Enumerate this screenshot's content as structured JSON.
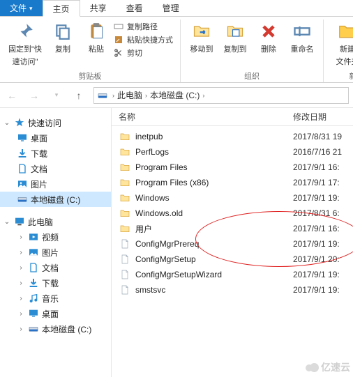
{
  "tabs": {
    "file": "文件",
    "home": "主页",
    "share": "共享",
    "view": "查看",
    "manage": "管理"
  },
  "ribbon": {
    "pin": {
      "l1": "固定到\"快",
      "l2": "速访问\""
    },
    "copy": "复制",
    "paste": "粘贴",
    "copy_path": "复制路径",
    "paste_shortcut": "粘贴快捷方式",
    "cut": "剪切",
    "clipboard_caption": "剪贴板",
    "move_to": "移动到",
    "copy_to": "复制到",
    "delete": "删除",
    "rename": "重命名",
    "new_folder": {
      "l1": "新建",
      "l2": "文件夹"
    },
    "organize_caption": "组织",
    "new_caption": "新"
  },
  "breadcrumb": {
    "root": "此电脑",
    "drive": "本地磁盘 (C:)"
  },
  "tree": {
    "quick_access": "快速访问",
    "desktop": "桌面",
    "downloads": "下载",
    "documents": "文档",
    "pictures": "图片",
    "local_disk": "本地磁盘 (C:)",
    "this_pc": "此电脑",
    "videos": "视频",
    "pictures2": "图片",
    "documents2": "文档",
    "downloads2": "下载",
    "music": "音乐",
    "desktop2": "桌面",
    "local_disk2": "本地磁盘 (C:)"
  },
  "list": {
    "col_name": "名称",
    "col_date": "修改日期",
    "items": [
      {
        "name": "inetpub",
        "type": "folder",
        "date": "2017/8/31 19"
      },
      {
        "name": "PerfLogs",
        "type": "folder",
        "date": "2016/7/16 21"
      },
      {
        "name": "Program Files",
        "type": "folder",
        "date": "2017/9/1 16:"
      },
      {
        "name": "Program Files (x86)",
        "type": "folder",
        "date": "2017/9/1 17:"
      },
      {
        "name": "Windows",
        "type": "folder",
        "date": "2017/9/1 19:"
      },
      {
        "name": "Windows.old",
        "type": "folder",
        "date": "2017/8/31 6:"
      },
      {
        "name": "用户",
        "type": "folder",
        "date": "2017/9/1 16:"
      },
      {
        "name": "ConfigMgrPrereq",
        "type": "file",
        "date": "2017/9/1 19:"
      },
      {
        "name": "ConfigMgrSetup",
        "type": "file",
        "date": "2017/9/1 20:"
      },
      {
        "name": "ConfigMgrSetupWizard",
        "type": "file",
        "date": "2017/9/1 19:"
      },
      {
        "name": "smstsvc",
        "type": "file",
        "date": "2017/9/1 19:"
      }
    ]
  },
  "watermark": "亿速云"
}
